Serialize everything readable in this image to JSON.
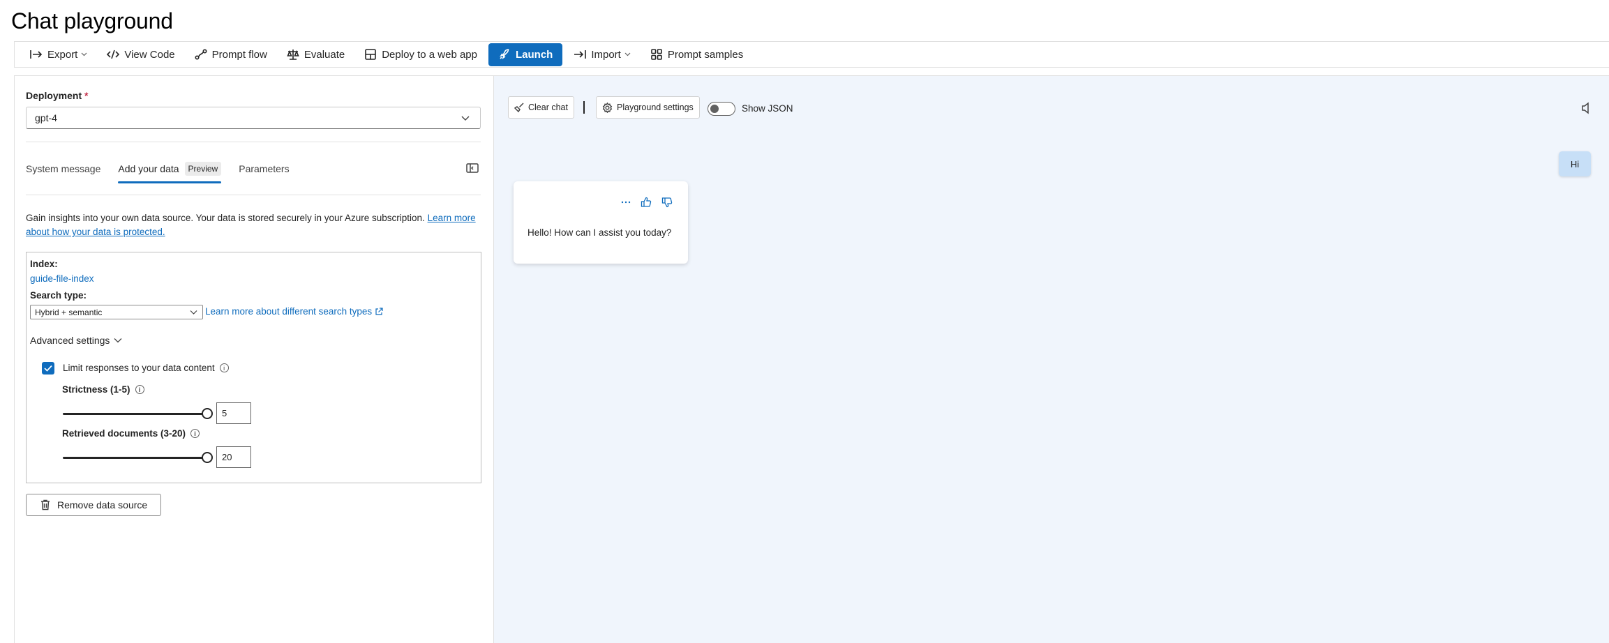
{
  "page": {
    "title": "Chat playground"
  },
  "toolbar": {
    "export": "Export",
    "view_code": "View Code",
    "prompt_flow": "Prompt flow",
    "evaluate": "Evaluate",
    "deploy": "Deploy to a web app",
    "launch": "Launch",
    "import": "Import",
    "prompt_samples": "Prompt samples",
    "launch_color": "#0f6cbd"
  },
  "setup": {
    "deployment_label": "Deployment",
    "required_mark": "*",
    "deployment_value": "gpt-4",
    "tabs": [
      {
        "label": "System message",
        "active": false
      },
      {
        "label": "Add your data",
        "active": true,
        "badge": "Preview"
      },
      {
        "label": "Parameters",
        "active": false
      }
    ],
    "description": "Gain insights into your own data source. Your data is stored securely in your Azure subscription.",
    "description_link": "Learn more about how your data is protected.",
    "index_label": "Index:",
    "index_value": "guide-file-index",
    "search_type_label": "Search type:",
    "search_type_value": "Hybrid + semantic",
    "search_types_link": "Learn more about different search types",
    "advanced_label": "Advanced settings",
    "limit_label": "Limit responses to your data content",
    "limit_checked": true,
    "strictness_label": "Strictness (1-5)",
    "strictness_value": "5",
    "retrieved_label": "Retrieved documents (3-20)",
    "retrieved_value": "20",
    "remove_label": "Remove data source"
  },
  "chat": {
    "clear_label": "Clear chat",
    "settings_label": "Playground settings",
    "show_json_label": "Show JSON",
    "show_json_on": false,
    "messages": [
      {
        "role": "user",
        "text": "Hi"
      },
      {
        "role": "assistant",
        "text": "Hello! How can I assist you today?"
      }
    ],
    "user_bubble_color": "#c7dff7",
    "background_color": "#f0f5fc"
  }
}
